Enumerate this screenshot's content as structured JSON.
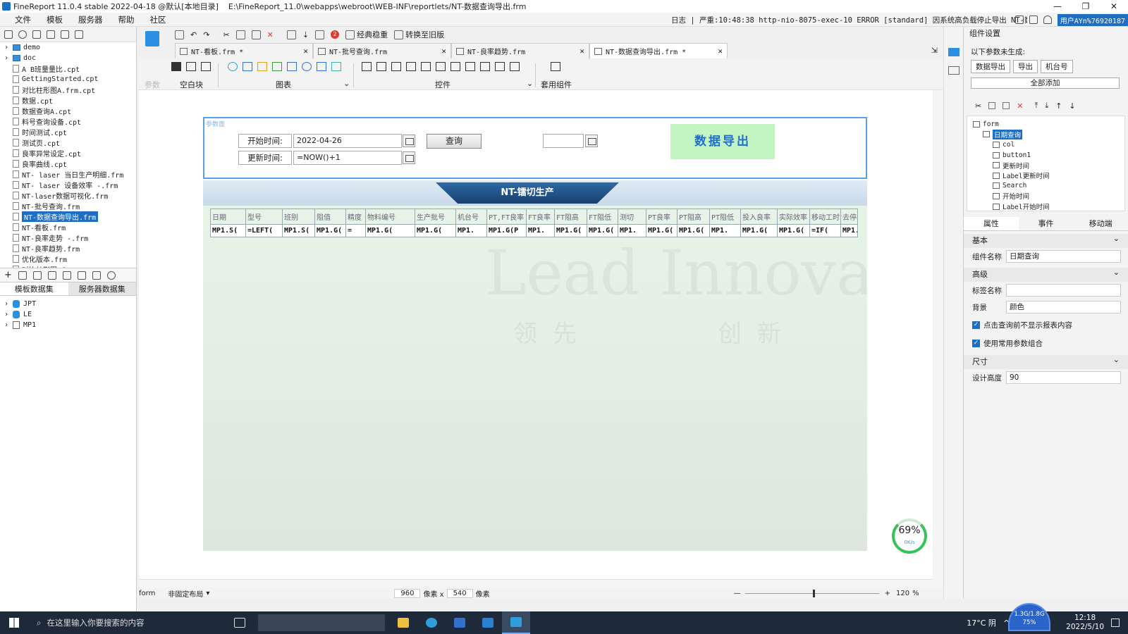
{
  "window": {
    "title": "FineReport 11.0.4 stable 2022-04-18 @默认[本地目录]",
    "path": "E:\\FineReport_11.0\\webapps\\webroot\\WEB-INF\\reportlets/NT-数据查询导出.frm",
    "controls": [
      "—",
      "❐",
      "✕"
    ]
  },
  "menu": {
    "items": [
      "文件",
      "模板",
      "服务器",
      "帮助",
      "社区"
    ],
    "log": "日志 | 严重:10:48:38 http-nio-8075-exec-10 ERROR [standard] 因系统高负载停止导出 NT-数据查询导出",
    "user": "用户AYn%76920187"
  },
  "left": {
    "files": [
      {
        "name": "demo",
        "type": "folder"
      },
      {
        "name": "doc",
        "type": "folder"
      },
      {
        "name": "A B班量量比.cpt",
        "type": "file"
      },
      {
        "name": "GettingStarted.cpt",
        "type": "file"
      },
      {
        "name": "对比柱形图A.frm.cpt",
        "type": "file"
      },
      {
        "name": "数据.cpt",
        "type": "file"
      },
      {
        "name": "数据查询A.cpt",
        "type": "file"
      },
      {
        "name": "料号查询设备.cpt",
        "type": "file"
      },
      {
        "name": "时间测试.cpt",
        "type": "file"
      },
      {
        "name": "测试页.cpt",
        "type": "file"
      },
      {
        "name": "良率异常设定.cpt",
        "type": "file"
      },
      {
        "name": "良率曲线.cpt",
        "type": "file"
      },
      {
        "name": "NT- laser 当日生产明细.frm",
        "type": "file"
      },
      {
        "name": "NT- laser 设备效率 -.frm",
        "type": "file"
      },
      {
        "name": "NT-laser数据可视化.frm",
        "type": "file"
      },
      {
        "name": "NT-批号查询.frm",
        "type": "file"
      },
      {
        "name": "NT-数据查询导出.frm",
        "type": "file",
        "selected": true
      },
      {
        "name": "NT-看板.frm",
        "type": "file"
      },
      {
        "name": "NT-良率走势 -.frm",
        "type": "file"
      },
      {
        "name": "NT-良率趋势.frm",
        "type": "file"
      },
      {
        "name": "优化版本.frm",
        "type": "file"
      },
      {
        "name": "对比柱形图.frm",
        "type": "file"
      }
    ],
    "ds_tabs": [
      "模板数据集",
      "服务器数据集"
    ],
    "datasets": [
      "JPT",
      "LE",
      "MP1"
    ]
  },
  "toolbar": {
    "classic_label": "经典稳重",
    "convert_label": "转换至旧版",
    "badge": "2"
  },
  "tabs": [
    {
      "label": "NT-看板.frm *"
    },
    {
      "label": "NT-批号查询.frm"
    },
    {
      "label": "NT-良率趋势.frm"
    },
    {
      "label": "NT-数据查询导出.frm *"
    }
  ],
  "widgetbar": {
    "param": "参数",
    "blank": "空白块",
    "chart": "图表",
    "control": "控件",
    "template": "套用组件"
  },
  "params": {
    "tag": "参数面",
    "start_label": "开始时间:",
    "start_value": "2022-04-26",
    "update_label": "更新时间:",
    "update_value": "=NOW()+1",
    "query_button": "查询",
    "export_button": "数据导出"
  },
  "report": {
    "title": "NT-镭切生产",
    "watermark": "Lead Innovation",
    "wm_a": [
      "领",
      "先"
    ],
    "wm_b": [
      "创",
      "新"
    ],
    "headers": [
      "日期",
      "型号",
      "班别",
      "阻值",
      "精度",
      "物料编号",
      "生产批号",
      "机台号",
      "PT,FT良率",
      "FT良率",
      "FT阻高",
      "FT阻低",
      "测切",
      "PT良率",
      "PT阻高",
      "PT阻低",
      "投入良率",
      "实际效率",
      "移动工时",
      "去停间"
    ],
    "formulas": [
      "MP1.S(",
      "=LEFT(",
      "MP1.S(",
      "MP1.G(",
      "=",
      "MP1.G(",
      "MP1.G(",
      "MP1.",
      "MP1.G(P",
      "MP1.",
      "MP1.G(",
      "MP1.G(",
      "MP1.",
      "MP1.G(",
      "MP1.G(",
      "MP1.",
      "MP1.G(",
      "MP1.G(",
      "=IF(",
      "MP1."
    ]
  },
  "status": {
    "form": "form",
    "layout": "非固定布局",
    "width": "960",
    "unit1": "像素 x",
    "height": "540",
    "unit2": "像素",
    "zoom": "120",
    "pct": "%",
    "gauge_pct": "69%",
    "gauge_speed": "0K/s"
  },
  "right": {
    "title": "组件设置",
    "not_generated": "以下参数未生成:",
    "pending": [
      "数据导出",
      "导出",
      "机台号"
    ],
    "add_all": "全部添加",
    "tree": [
      {
        "label": "form",
        "depth": 0
      },
      {
        "label": "日期查询",
        "depth": 1,
        "selected": true
      },
      {
        "label": "col",
        "depth": 2
      },
      {
        "label": "button1",
        "depth": 2
      },
      {
        "label": "更新时间",
        "depth": 2
      },
      {
        "label": "Label更新时间",
        "depth": 2
      },
      {
        "label": "Search",
        "depth": 2
      },
      {
        "label": "开始时间",
        "depth": 2
      },
      {
        "label": "Label开始时间",
        "depth": 2
      }
    ],
    "ptabs": [
      "属性",
      "事件",
      "移动端"
    ],
    "basic": "基本",
    "name_label": "组件名称",
    "name_value": "日期查询",
    "advanced": "高级",
    "tag_label": "标签名称",
    "tag_value": "",
    "bg_label": "背景",
    "bg_value": "颜色",
    "chk1": "点击查询前不显示报表内容",
    "chk2": "使用常用参数组合",
    "size": "尺寸",
    "height_label": "设计高度",
    "height_value": "90"
  },
  "taskbar": {
    "search": "在这里输入你要搜索的内容",
    "weather": "17°C 阴",
    "time": "12:18",
    "date": "2022/5/10",
    "net": "1.3G/1.8G",
    "net_pct": "75%"
  }
}
